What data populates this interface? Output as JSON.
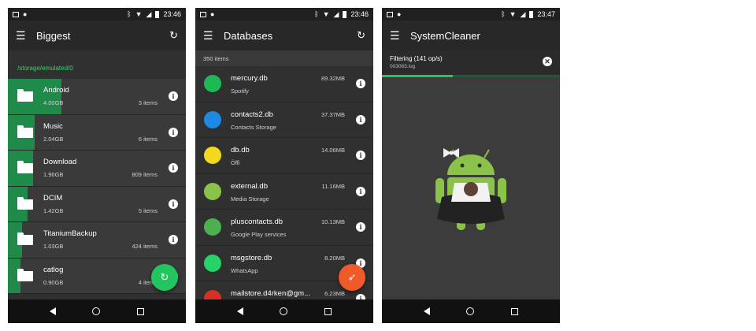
{
  "status_bar": {
    "screen1_time": "23:46",
    "screen2_time": "23:46",
    "screen3_time": "23:47"
  },
  "screen1": {
    "title": "Biggest",
    "path": "/storage/emulated/0",
    "folders": [
      {
        "name": "Android",
        "size": "4.00GB",
        "count": "3 items",
        "share": 0.3
      },
      {
        "name": "Music",
        "size": "2.04GB",
        "count": "6 items",
        "share": 0.15
      },
      {
        "name": "Download",
        "size": "1.96GB",
        "count": "809 items",
        "share": 0.14
      },
      {
        "name": "DCIM",
        "size": "1.42GB",
        "count": "5 items",
        "share": 0.11
      },
      {
        "name": "TitaniumBackup",
        "size": "1.03GB",
        "count": "424 items",
        "share": 0.08
      },
      {
        "name": "catlog",
        "size": "0.90GB",
        "count": "4 items",
        "share": 0.07
      }
    ]
  },
  "screen2": {
    "title": "Databases",
    "item_count": "350 items",
    "databases": [
      {
        "name": "mercury.db",
        "app": "Spotify",
        "size": "89.32MB",
        "icon": "spotify-icon",
        "color": "#1db954"
      },
      {
        "name": "contacts2.db",
        "app": "Contacts Storage",
        "size": "37.37MB",
        "icon": "contacts-icon",
        "color": "#1e88e5"
      },
      {
        "name": "db.db",
        "app": "Öffi",
        "size": "14.06MB",
        "icon": "offi-icon",
        "color": "#f2d81e"
      },
      {
        "name": "external.db",
        "app": "Media Storage",
        "size": "11.16MB",
        "icon": "android-icon",
        "color": "#8bc34a"
      },
      {
        "name": "pluscontacts.db",
        "app": "Google Play services",
        "size": "10.13MB",
        "icon": "play-services-icon",
        "color": "#4caf50"
      },
      {
        "name": "msgstore.db",
        "app": "WhatsApp",
        "size": "8.20MB",
        "icon": "whatsapp-icon",
        "color": "#25d366"
      },
      {
        "name": "mailstore.d4rken@gm...",
        "app": "",
        "size": "6.23MB",
        "icon": "gmail-icon",
        "color": "#d93025"
      }
    ]
  },
  "screen3": {
    "title": "SystemCleaner",
    "filter_title": "Filtering (141 op/s)",
    "filter_file": "003083.log",
    "progress": 0.4
  },
  "colors": {
    "accent_green": "#22c55e",
    "bar_green": "#1f8a4a",
    "fab_orange": "#f05a28"
  }
}
